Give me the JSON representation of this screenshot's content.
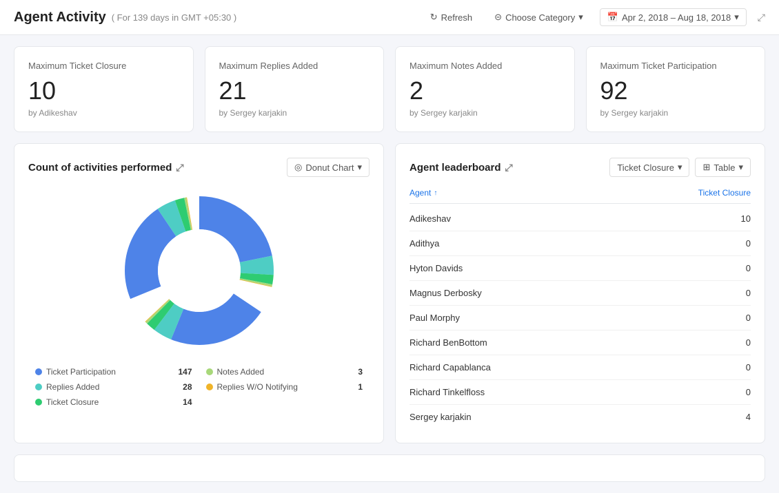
{
  "header": {
    "title": "Agent Activity",
    "subtitle": "( For 139 days in GMT +05:30 )",
    "refresh_label": "Refresh",
    "category_label": "Choose Category",
    "date_range": "Apr 2, 2018 – Aug 18, 2018"
  },
  "summary_cards": [
    {
      "label": "Maximum Ticket Closure",
      "value": "10",
      "by": "by Adikeshav"
    },
    {
      "label": "Maximum Replies Added",
      "value": "21",
      "by": "by Sergey karjakin"
    },
    {
      "label": "Maximum Notes Added",
      "value": "2",
      "by": "by Sergey karjakin"
    },
    {
      "label": "Maximum Ticket Participation",
      "value": "92",
      "by": "by Sergey karjakin"
    }
  ],
  "donut_chart": {
    "title": "Count of activities performed",
    "chart_type_label": "Donut Chart",
    "segments": [
      {
        "label": "Ticket Participation",
        "count": 147,
        "color": "#4e83e8",
        "percent": 72
      },
      {
        "label": "Replies Added",
        "count": 28,
        "color": "#4ecdc4",
        "percent": 14
      },
      {
        "label": "Ticket Closure",
        "count": 14,
        "color": "#2ecc71",
        "percent": 7
      },
      {
        "label": "Notes Added",
        "count": 3,
        "color": "#a8d87a",
        "percent": 2
      },
      {
        "label": "Replies W/O Notifying",
        "count": 1,
        "color": "#f0b429",
        "percent": 1
      }
    ]
  },
  "leaderboard": {
    "title": "Agent leaderboard",
    "category_label": "Ticket Closure",
    "view_label": "Table",
    "col_agent": "Agent",
    "col_value": "Ticket Closure",
    "rows": [
      {
        "agent": "Adikeshav",
        "value": 10
      },
      {
        "agent": "Adithya",
        "value": 0
      },
      {
        "agent": "Hyton Davids",
        "value": 0
      },
      {
        "agent": "Magnus Derbosky",
        "value": 0
      },
      {
        "agent": "Paul Morphy",
        "value": 0
      },
      {
        "agent": "Richard BenBottom",
        "value": 0
      },
      {
        "agent": "Richard Capablanca",
        "value": 0
      },
      {
        "agent": "Richard Tinkelfloss",
        "value": 0
      },
      {
        "agent": "Sergey karjakin",
        "value": 4
      }
    ]
  },
  "icons": {
    "refresh": "↻",
    "filter": "⊝",
    "calendar": "📅",
    "expand": "⤢",
    "chart": "◎",
    "table": "⊞",
    "chevron_down": "▾",
    "sort_up": "↑"
  }
}
